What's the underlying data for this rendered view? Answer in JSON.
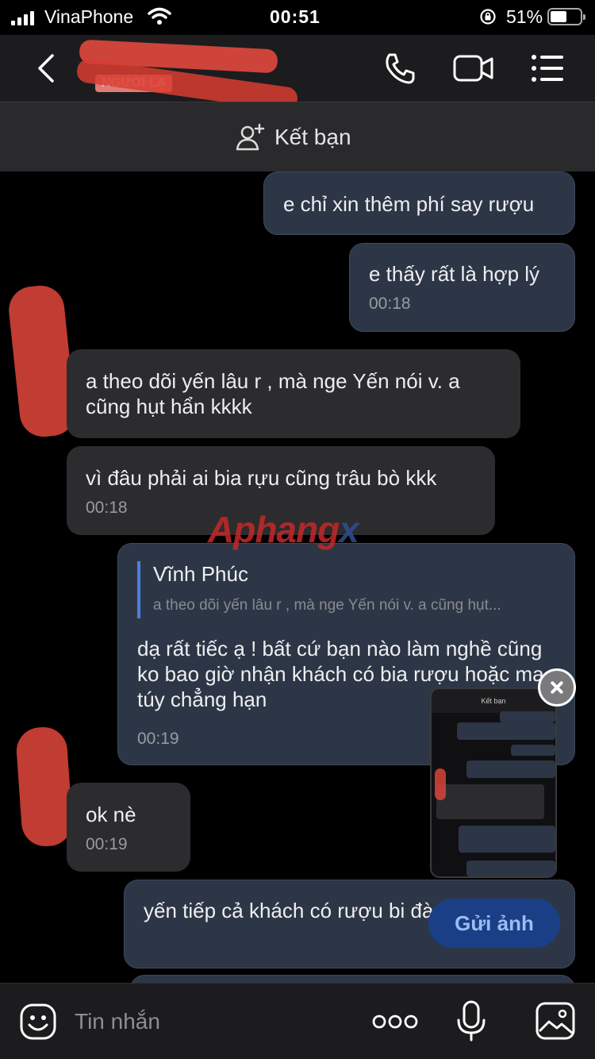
{
  "status_bar": {
    "carrier": "VinaPhone",
    "time": "00:51",
    "battery": "51%"
  },
  "header": {
    "badge": "NGƯỜI LẠ",
    "icons": [
      "back-icon",
      "phone-icon",
      "video-call-icon",
      "menu-icon"
    ]
  },
  "add_friend": {
    "label": "Kết bạn",
    "icon": "add-person-icon"
  },
  "messages": [
    {
      "from": "me",
      "text": "e chỉ xin thêm phí say rượu"
    },
    {
      "from": "me",
      "text": "e thấy rất là hợp lý",
      "time": "00:18"
    },
    {
      "from": "them",
      "text": "a theo dõi yến lâu r , mà nge Yến nói v. a cũng hụt hẩn kkkk"
    },
    {
      "from": "them",
      "text": "vì đâu phải ai bia rựu cũng trâu bò kkk",
      "time": "00:18"
    },
    {
      "from": "me",
      "quote_name": "Vĩnh Phúc",
      "quote_text": "a theo dõi yến lâu r , mà nge Yến nói v. a cũng hụt...",
      "text": "dạ rất tiếc ạ ! bất cứ bạn nào làm nghề cũng ko bao giờ nhận khách có bia rượu hoặc ma túy chẳng hạn",
      "time": "00:19"
    },
    {
      "from": "them",
      "text": "ok nè",
      "time": "00:19"
    },
    {
      "from": "me",
      "text": "yến tiếp cả khách có rượu bi đà rồi ạ"
    }
  ],
  "watermark": {
    "main": "Aphang",
    "accent": "x"
  },
  "preview": {
    "header": "Kết bạn",
    "send_label": "Gửi ảnh"
  },
  "input_bar": {
    "placeholder": "Tin nhắn",
    "icons": [
      "emoji-icon",
      "more-icon",
      "mic-icon",
      "image-icon"
    ]
  },
  "colors": {
    "background": "#000000",
    "my_bubble": "#2c3646",
    "their_bubble": "#2c2c2e",
    "quote_bar": "#4d7fe0",
    "send_button": "#1b3f86"
  }
}
